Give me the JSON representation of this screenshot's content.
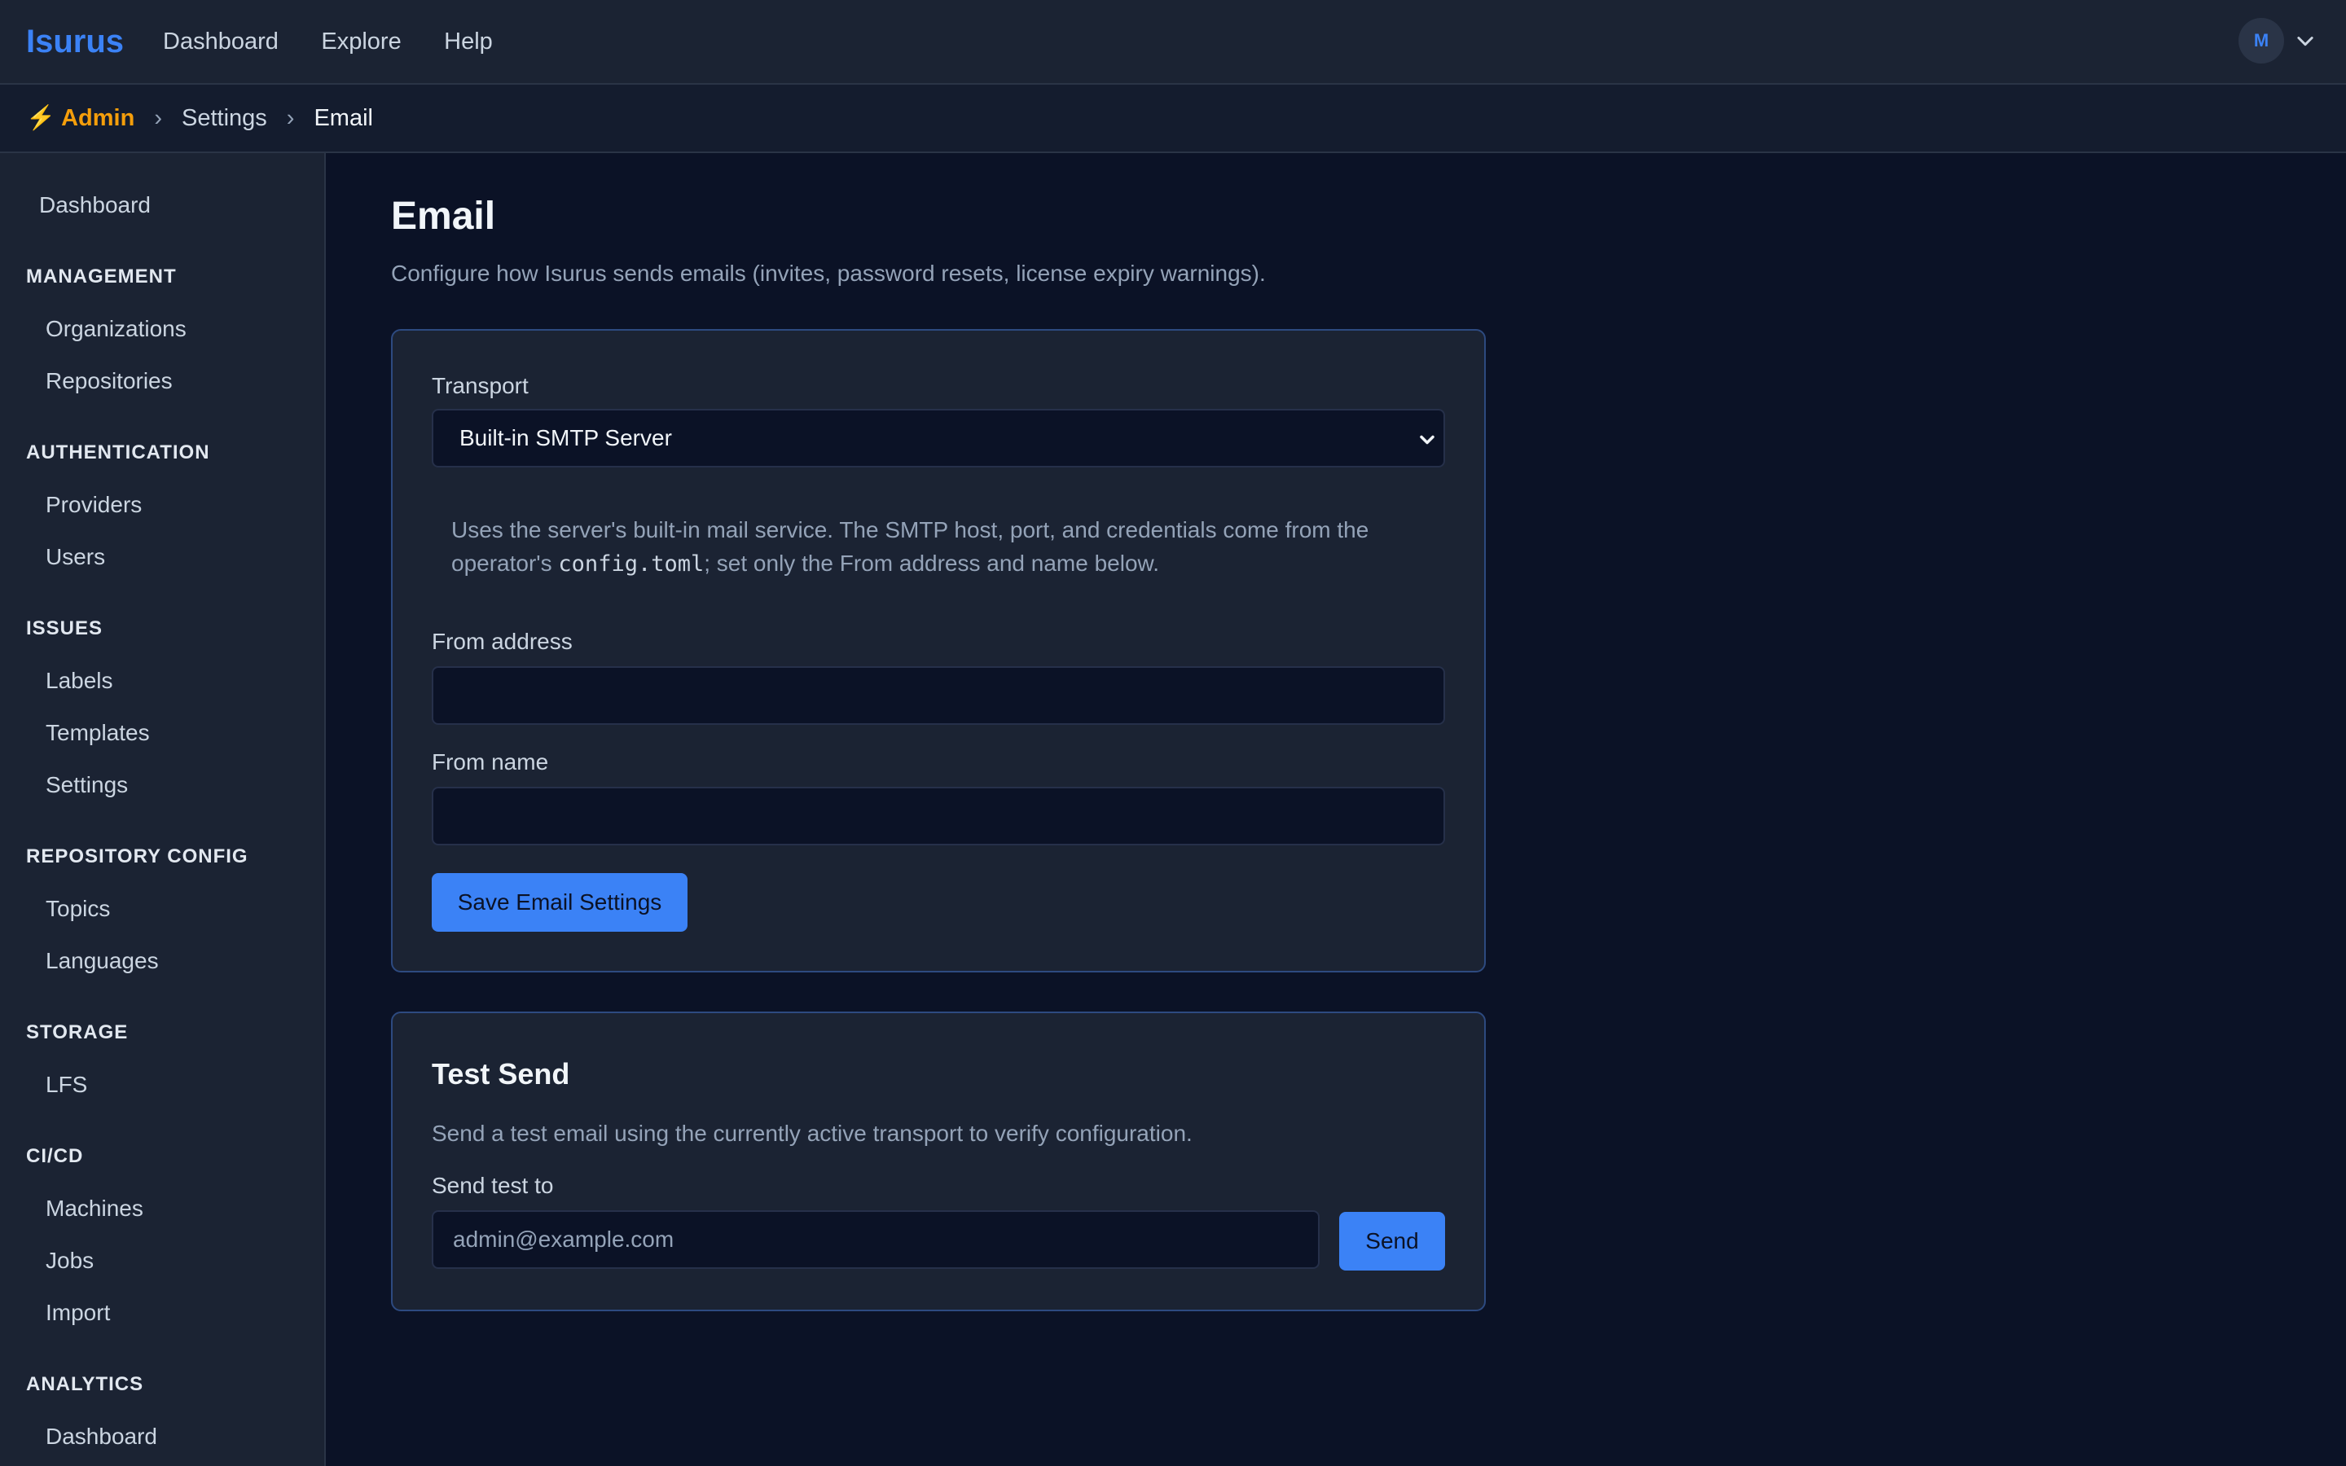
{
  "header": {
    "brand": "Isurus",
    "nav": [
      "Dashboard",
      "Explore",
      "Help"
    ],
    "avatar_initial": "M"
  },
  "breadcrumb": {
    "admin": "⚡ Admin",
    "separator": "›",
    "settings": "Settings",
    "current": "Email"
  },
  "sidebar": {
    "top_item": "Dashboard",
    "sections": [
      {
        "title": "MANAGEMENT",
        "items": [
          "Organizations",
          "Repositories"
        ]
      },
      {
        "title": "AUTHENTICATION",
        "items": [
          "Providers",
          "Users"
        ]
      },
      {
        "title": "ISSUES",
        "items": [
          "Labels",
          "Templates",
          "Settings"
        ]
      },
      {
        "title": "REPOSITORY CONFIG",
        "items": [
          "Topics",
          "Languages"
        ]
      },
      {
        "title": "STORAGE",
        "items": [
          "LFS"
        ]
      },
      {
        "title": "CI/CD",
        "items": [
          "Machines",
          "Jobs",
          "Import"
        ]
      },
      {
        "title": "ANALYTICS",
        "items": [
          "Dashboard"
        ]
      }
    ]
  },
  "page": {
    "title": "Email",
    "description": "Configure how Isurus sends emails (invites, password resets, license expiry warnings)."
  },
  "email_card": {
    "transport_label": "Transport",
    "transport_value": "Built-in SMTP Server",
    "info_part1": "Uses the server's built-in mail service. The SMTP host, port, and credentials come from the operator's ",
    "info_code": "config.toml",
    "info_part2": "; set only the From address and name below.",
    "from_address_label": "From address",
    "from_address_value": "",
    "from_name_label": "From name",
    "from_name_value": "",
    "save_button": "Save Email Settings"
  },
  "test_card": {
    "title": "Test Send",
    "description": "Send a test email using the currently active transport to verify configuration.",
    "send_to_label": "Send test to",
    "send_to_placeholder": "admin@example.com",
    "send_button": "Send"
  },
  "colors": {
    "accent": "#3b82f6",
    "admin": "#f59e0b",
    "background": "#0b1226",
    "panel": "#1b2333"
  }
}
